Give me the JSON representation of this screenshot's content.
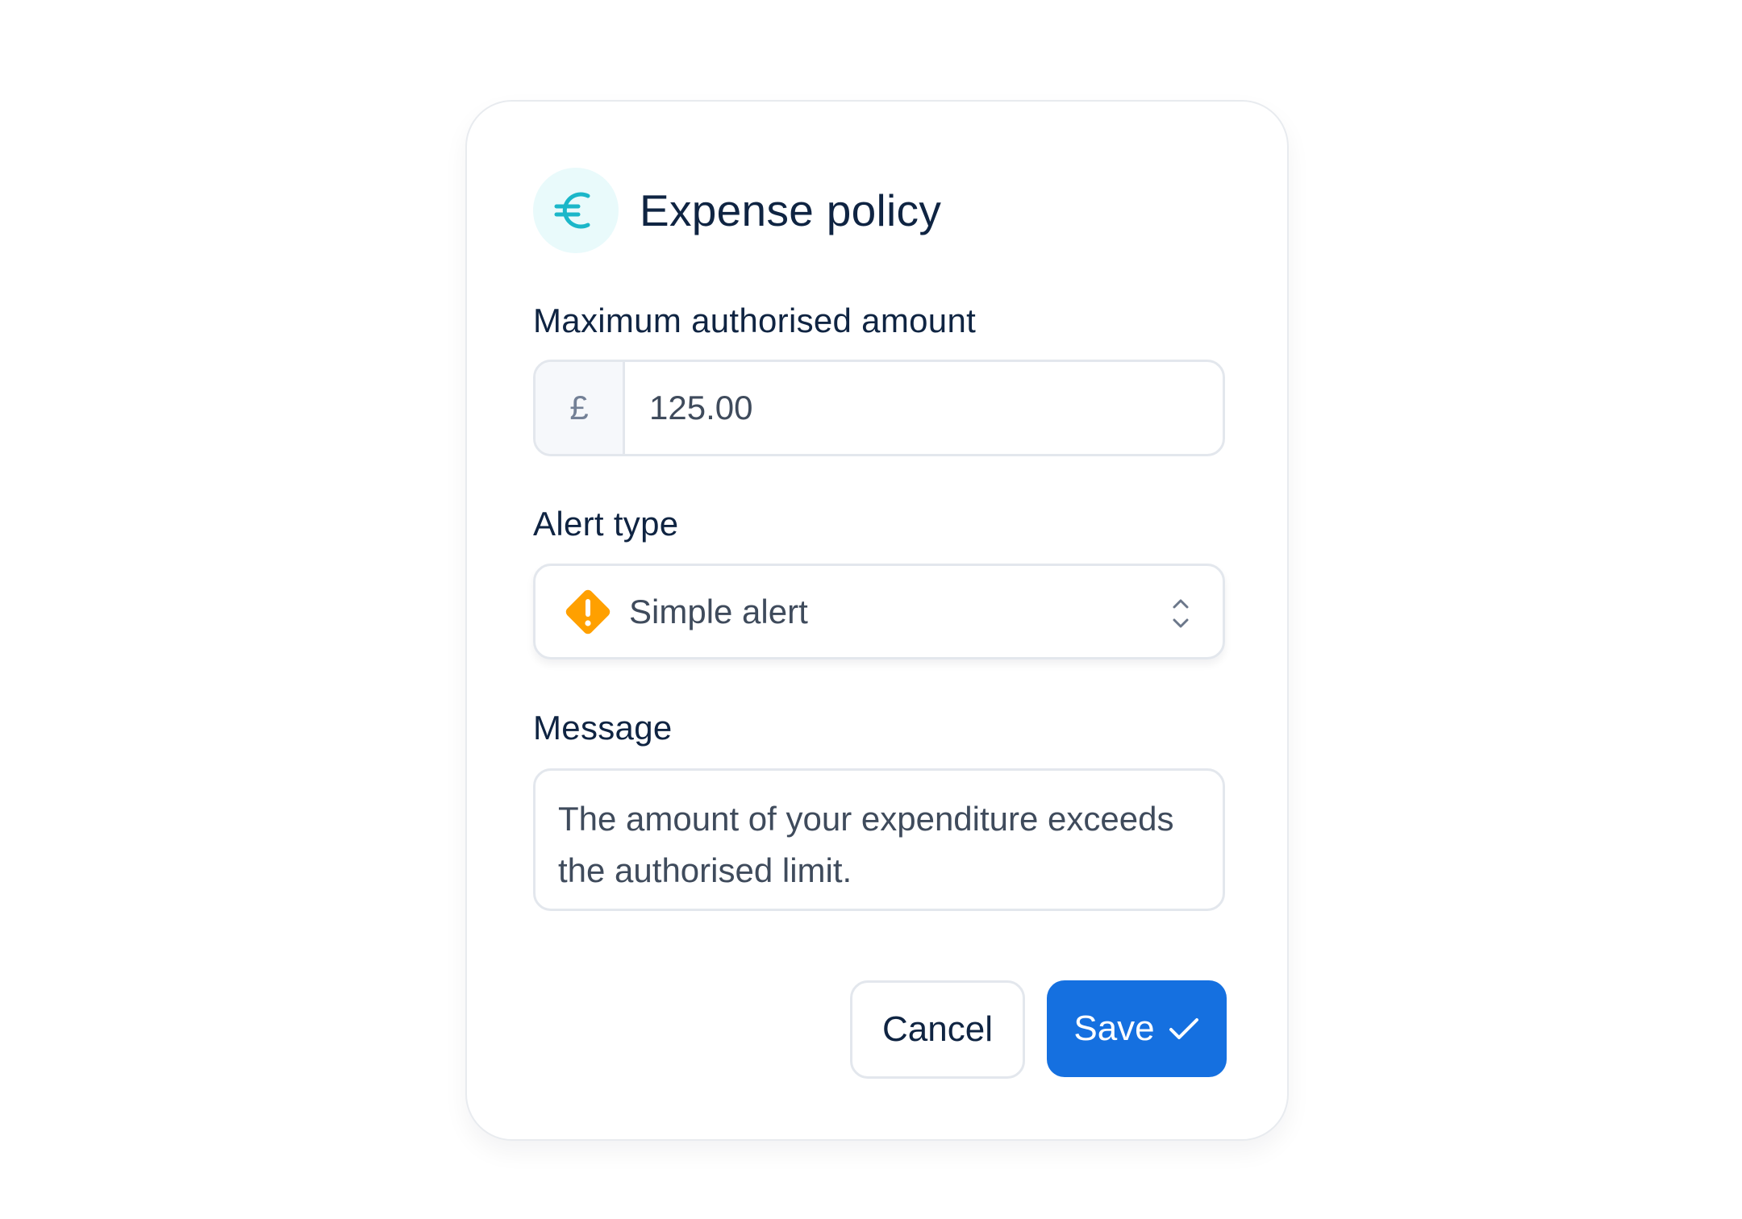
{
  "dialog": {
    "title": "Expense policy",
    "header_icon": "euro-icon",
    "accent_color": "#1bb7c9",
    "accent_bg": "#e9fafb"
  },
  "amount_field": {
    "label": "Maximum authorised amount",
    "currency_symbol": "£",
    "value": "125.00"
  },
  "alert_type": {
    "label": "Alert type",
    "selected": "Simple alert",
    "icon": "warning-diamond-icon",
    "icon_color": "#ffa000"
  },
  "message": {
    "label": "Message",
    "value": "The amount of your expenditure exceeds the authorised limit."
  },
  "actions": {
    "cancel_label": "Cancel",
    "save_label": "Save",
    "save_color": "#1570e0"
  }
}
